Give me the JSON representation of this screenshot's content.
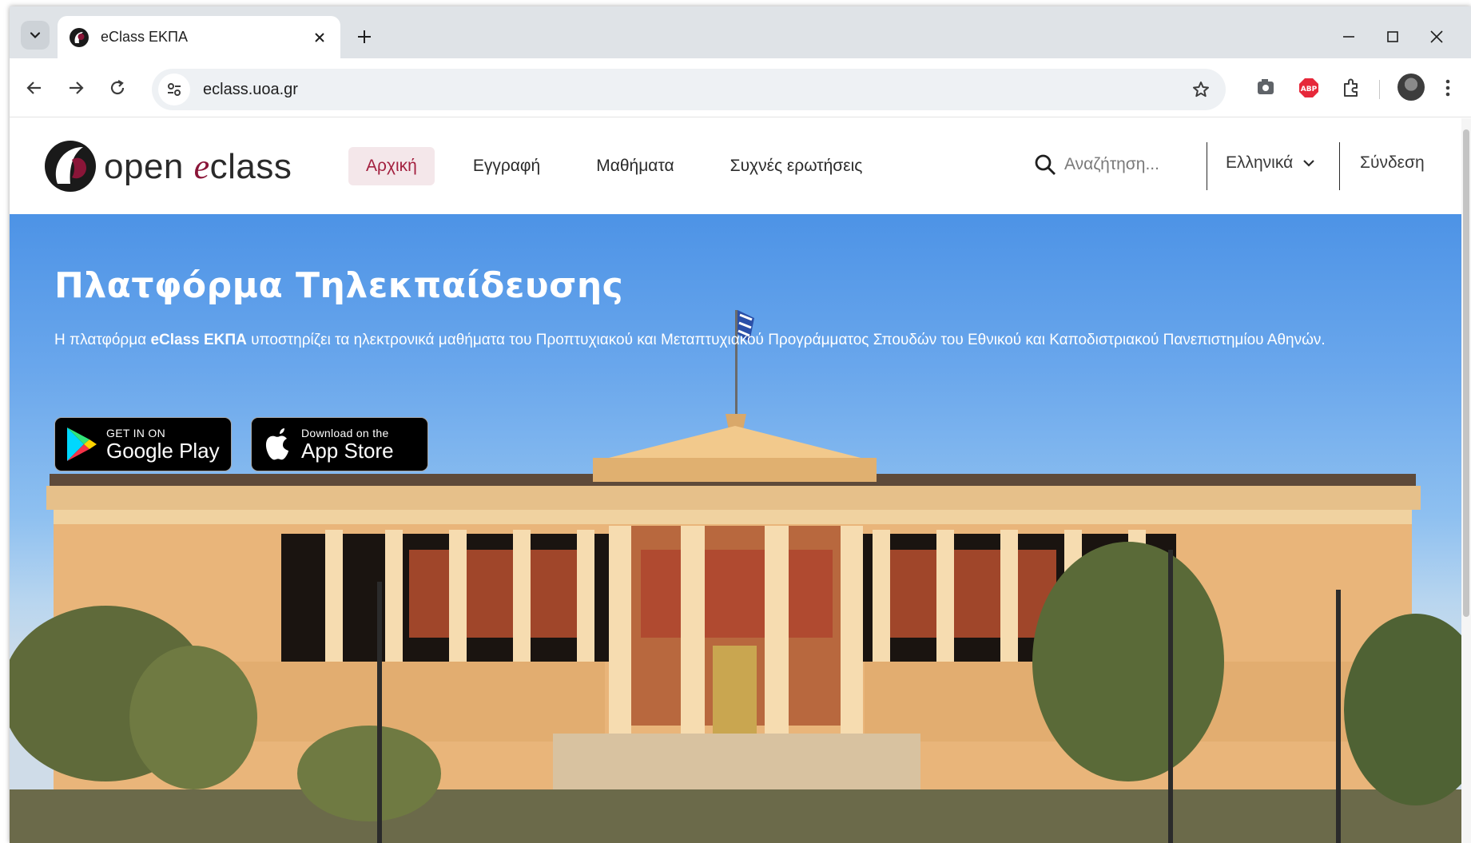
{
  "browser": {
    "tab_title": "eClass ΕΚΠΑ",
    "url": "eclass.uoa.gr",
    "extensions": [
      "camera-extension-icon",
      "adblock-plus-icon",
      "puzzle-extensions-icon"
    ],
    "abp_label": "ABP"
  },
  "site": {
    "logo_prefix": "open ",
    "logo_e": "e",
    "logo_suffix": "class",
    "nav": [
      {
        "label": "Αρχική",
        "active": true
      },
      {
        "label": "Εγγραφή",
        "active": false
      },
      {
        "label": "Μαθήματα",
        "active": false
      },
      {
        "label": "Συχνές ερωτήσεις",
        "active": false
      }
    ],
    "search_placeholder": "Αναζήτηση...",
    "language": "Ελληνικά",
    "login": "Σύνδεση"
  },
  "hero": {
    "title": "Πλατφόρμα Τηλεκπαίδευσης",
    "desc_before": "Η πλατφόρμα ",
    "desc_bold": "eClass ΕΚΠΑ",
    "desc_after": " υποστηρίζει τα ηλεκτρονικά μαθήματα του Προπτυχιακού και Μεταπτυχιακού Προγράμματος Σπουδών του Εθνικού και Καποδιστριακού Πανεπιστημίου Αθηνών.",
    "google_play": {
      "small": "GET IN ON",
      "big": "Google Play"
    },
    "app_store": {
      "small": "Download on the",
      "big": "App Store"
    }
  },
  "colors": {
    "brand": "#8a1538",
    "nav_active_bg": "#f4e7ea",
    "sky_top": "#4d93e6"
  }
}
